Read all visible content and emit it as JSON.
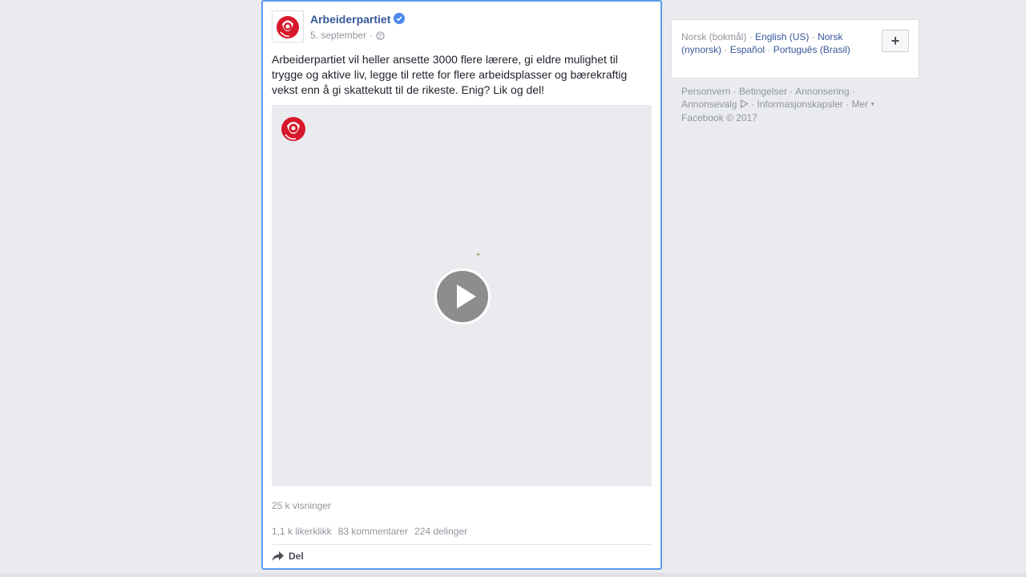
{
  "post": {
    "page_name": "Arbeiderpartiet",
    "date": "5. september",
    "date_separator": "·",
    "text": "Arbeiderpartiet vil heller ansette 3000 flere lærere, gi eldre mulighet til trygge og aktive liv, legge til rette for flere arbeidsplasser og bærekraftig vekst enn å gi skattekutt til de rikeste. Enig? Lik og del!",
    "views": "25 k visninger",
    "likes": "1,1 k likerklikk",
    "comments": "83 kommentarer",
    "shares": "224 delinger",
    "share_label": "Del",
    "icons": {
      "avatar": "rose-logo-icon",
      "verified": "verified-check-icon",
      "privacy": "globe-icon",
      "play": "play-icon",
      "share": "share-arrow-icon"
    },
    "colors": {
      "brand": "#d7182a",
      "link": "#365899",
      "verified": "#4b88ef",
      "focus_border": "#5b9bf0"
    }
  },
  "languages": {
    "current": "Norsk (bokmål)",
    "links": [
      "English (US)",
      "Norsk (nynorsk)",
      "Español",
      "Português (Brasil)"
    ],
    "add_button": "+"
  },
  "footer": {
    "links": [
      "Personvern",
      "Betingelser",
      "Annonsering",
      "Annonsevalg",
      "Informasjonskapsler",
      "Mer"
    ],
    "copyright": "Facebook © 2017"
  }
}
